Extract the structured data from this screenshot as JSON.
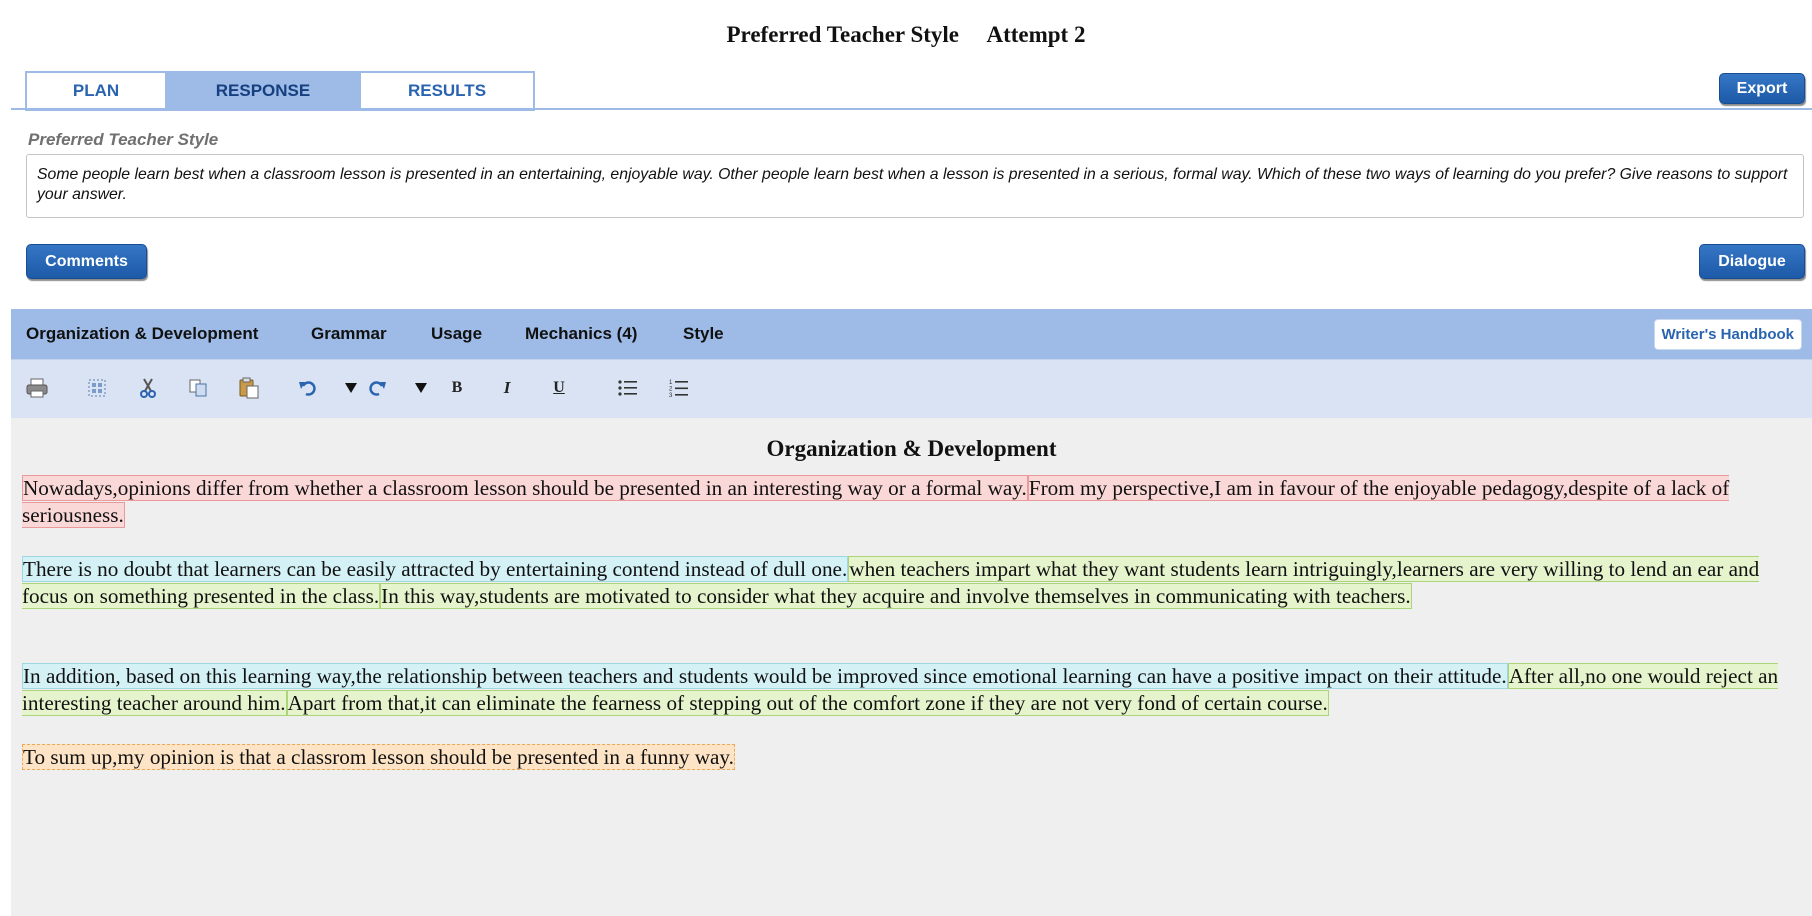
{
  "header": {
    "title": "Preferred Teacher Style     Attempt 2"
  },
  "tabs": [
    {
      "label": "PLAN"
    },
    {
      "label": "RESPONSE"
    },
    {
      "label": "RESULTS"
    }
  ],
  "buttons": {
    "export": "Export",
    "comments": "Comments",
    "dialogue": "Dialogue"
  },
  "prompt": {
    "label": "Preferred Teacher Style",
    "text": "Some people learn best when a classroom lesson is presented in an entertaining, enjoyable way. Other people learn best when a lesson is presented in a serious, formal way. Which of these two ways of learning do you prefer? Give reasons to support your answer."
  },
  "categories": {
    "items": [
      {
        "label": "Organization & Development"
      },
      {
        "label": "Grammar"
      },
      {
        "label": "Usage"
      },
      {
        "label": "Mechanics (4)"
      },
      {
        "label": "Style"
      }
    ],
    "handbook": "Writer's Handbook"
  },
  "toolbar": {
    "icons": [
      "print-icon",
      "select-all-icon",
      "cut-icon",
      "copy-icon",
      "paste-icon",
      "undo-icon",
      "undo-dropdown-icon",
      "redo-icon",
      "redo-dropdown-icon",
      "bold-icon",
      "italic-icon",
      "underline-icon",
      "bulleted-list-icon",
      "numbered-list-icon"
    ],
    "bold": "B",
    "italic": "I",
    "underline": "U"
  },
  "editor": {
    "title": "Organization & Development",
    "paragraphs": [
      [
        {
          "text": "Nowadays,opinions differ  from whether a classroom lesson should be presented in an interesting way or a formal way."
        },
        {
          "text": "From my perspective,I am in favour of  the enjoyable pedagogy,despite of a lack of seriousness."
        }
      ],
      [
        {
          "text": "There is no doubt that learners can be easily attracted by entertaining contend instead of dull one."
        },
        {
          "text": "when teachers impart what they want students learn intriguingly,learners are very willing to lend an ear and focus on something presented in the class."
        },
        {
          "text": "In this way,students are motivated to consider what they acquire and involve themselves in communicating with teachers."
        }
      ],
      [
        {
          "text": "In addition, based on this learning way,the relationship between teachers and students would be improved since emotional learning can have a positive impact on their attitude."
        },
        {
          "text": "After all,no one would reject an interesting teacher around him."
        },
        {
          "text": "Apart from that,it can eliminate the fearness of stepping out of the comfort zone if they are not very fond of certain course."
        }
      ],
      [
        {
          "text": "To sum up,my opinion is that a classrom lesson should be presented in a funny way."
        }
      ]
    ]
  },
  "colors": {
    "accent_blue": "#2a64b0",
    "tab_active": "#9dbbe6",
    "highlight_intro": "#fbd8d8",
    "highlight_topic": "#d4f1f6",
    "highlight_support": "#e6f4cd",
    "highlight_conclusion": "#fde4c6"
  }
}
